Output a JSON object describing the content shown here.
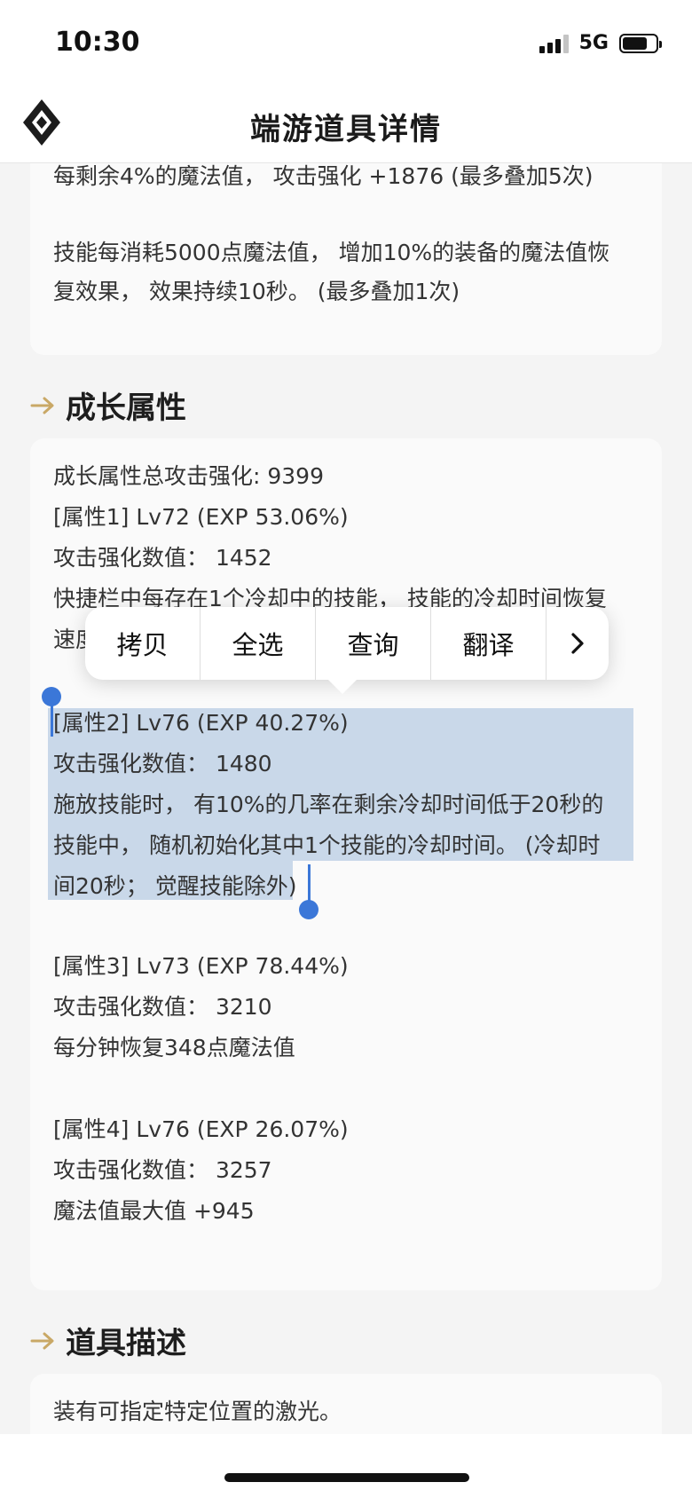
{
  "status": {
    "time": "10:30",
    "network": "5G"
  },
  "nav": {
    "title": "端游道具详情"
  },
  "top_card": {
    "lines": [
      "每剩余4%的魔法值， 攻击强化 +1876 (最多叠加5次)",
      "技能每消耗5000点魔法值， 增加10%的装备的魔法值恢",
      "复效果， 效果持续10秒。 (最多叠加1次)"
    ]
  },
  "growth": {
    "title": "成长属性",
    "total": "成长属性总攻击强化: 9399",
    "attr1": {
      "header": "[属性1] Lv72 (EXP 53.06%)",
      "value": "攻击强化数值： 1452",
      "desc1": "快捷栏中每存在1个冷却中的技能， 技能的冷却时间恢复",
      "desc2": "速度"
    },
    "attr2": {
      "header": "[属性2] Lv76 (EXP 40.27%)",
      "value": "攻击强化数值： 1480",
      "desc1": "施放技能时， 有10%的几率在剩余冷却时间低于20秒的",
      "desc2": "技能中， 随机初始化其中1个技能的冷却时间。 (冷却时",
      "desc3": "间20秒； 觉醒技能除外)"
    },
    "attr3": {
      "header": "[属性3] Lv73 (EXP 78.44%)",
      "value": "攻击强化数值： 3210",
      "desc1": "每分钟恢复348点魔法值"
    },
    "attr4": {
      "header": "[属性4] Lv76 (EXP 26.07%)",
      "value": "攻击强化数值： 3257",
      "desc1": "魔法值最大值 +945"
    }
  },
  "description": {
    "title": "道具描述",
    "text": "装有可指定特定位置的激光。"
  },
  "context_menu": {
    "copy": "拷贝",
    "select_all": "全选",
    "lookup": "查询",
    "translate": "翻译"
  },
  "colors": {
    "accent": "#c9a866",
    "selection": "#a9bfd9",
    "handle": "#3b77d8"
  }
}
